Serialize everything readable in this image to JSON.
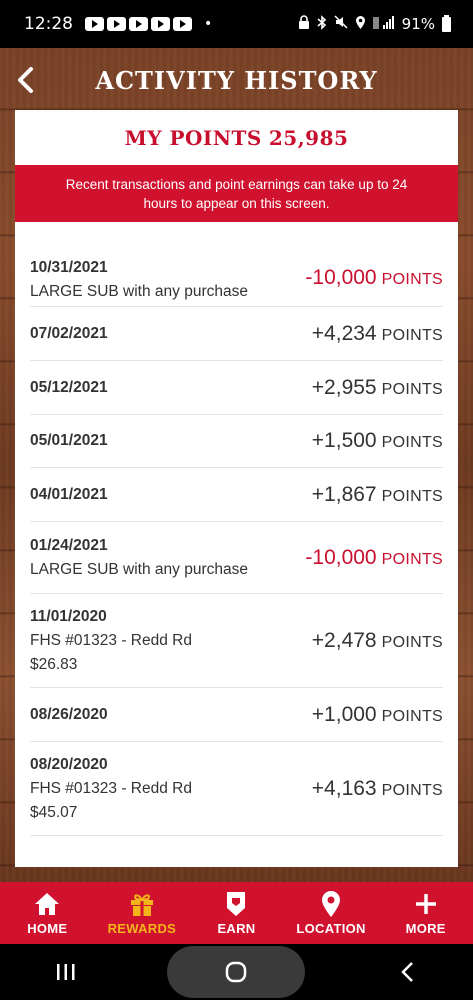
{
  "status_bar": {
    "time": "12:28",
    "battery": "91%"
  },
  "header": {
    "title": "ACTIVITY HISTORY"
  },
  "points": {
    "label": "MY POINTS",
    "value": "25,985"
  },
  "notice": "Recent transactions and point earnings can take up to 24 hours to appear on this screen.",
  "transactions": [
    {
      "date": "10/31/2021",
      "desc": "LARGE SUB with any purchase",
      "desc2": "",
      "amount": "-10,000",
      "unit": "POINTS",
      "negative": true
    },
    {
      "date": "07/02/2021",
      "desc": "",
      "desc2": "",
      "amount": "+4,234",
      "unit": "POINTS",
      "negative": false
    },
    {
      "date": "05/12/2021",
      "desc": "",
      "desc2": "",
      "amount": "+2,955",
      "unit": "POINTS",
      "negative": false
    },
    {
      "date": "05/01/2021",
      "desc": "",
      "desc2": "",
      "amount": "+1,500",
      "unit": "POINTS",
      "negative": false
    },
    {
      "date": "04/01/2021",
      "desc": "",
      "desc2": "",
      "amount": "+1,867",
      "unit": "POINTS",
      "negative": false
    },
    {
      "date": "01/24/2021",
      "desc": "LARGE SUB with any purchase",
      "desc2": "",
      "amount": "-10,000",
      "unit": "POINTS",
      "negative": true
    },
    {
      "date": "11/01/2020",
      "desc": "FHS #01323 - Redd Rd",
      "desc2": "$26.83",
      "amount": "+2,478",
      "unit": "POINTS",
      "negative": false
    },
    {
      "date": "08/26/2020",
      "desc": "",
      "desc2": "",
      "amount": "+1,000",
      "unit": "POINTS",
      "negative": false
    },
    {
      "date": "08/20/2020",
      "desc": "FHS #01323 - Redd Rd",
      "desc2": "$45.07",
      "amount": "+4,163",
      "unit": "POINTS",
      "negative": false
    }
  ],
  "nav": {
    "home": "HOME",
    "rewards": "REWARDS",
    "earn": "EARN",
    "location": "LOCATION",
    "more": "MORE"
  },
  "colors": {
    "brand_red": "#d0122f",
    "active_nav": "#f3b51a",
    "negative": "#c8102e"
  }
}
